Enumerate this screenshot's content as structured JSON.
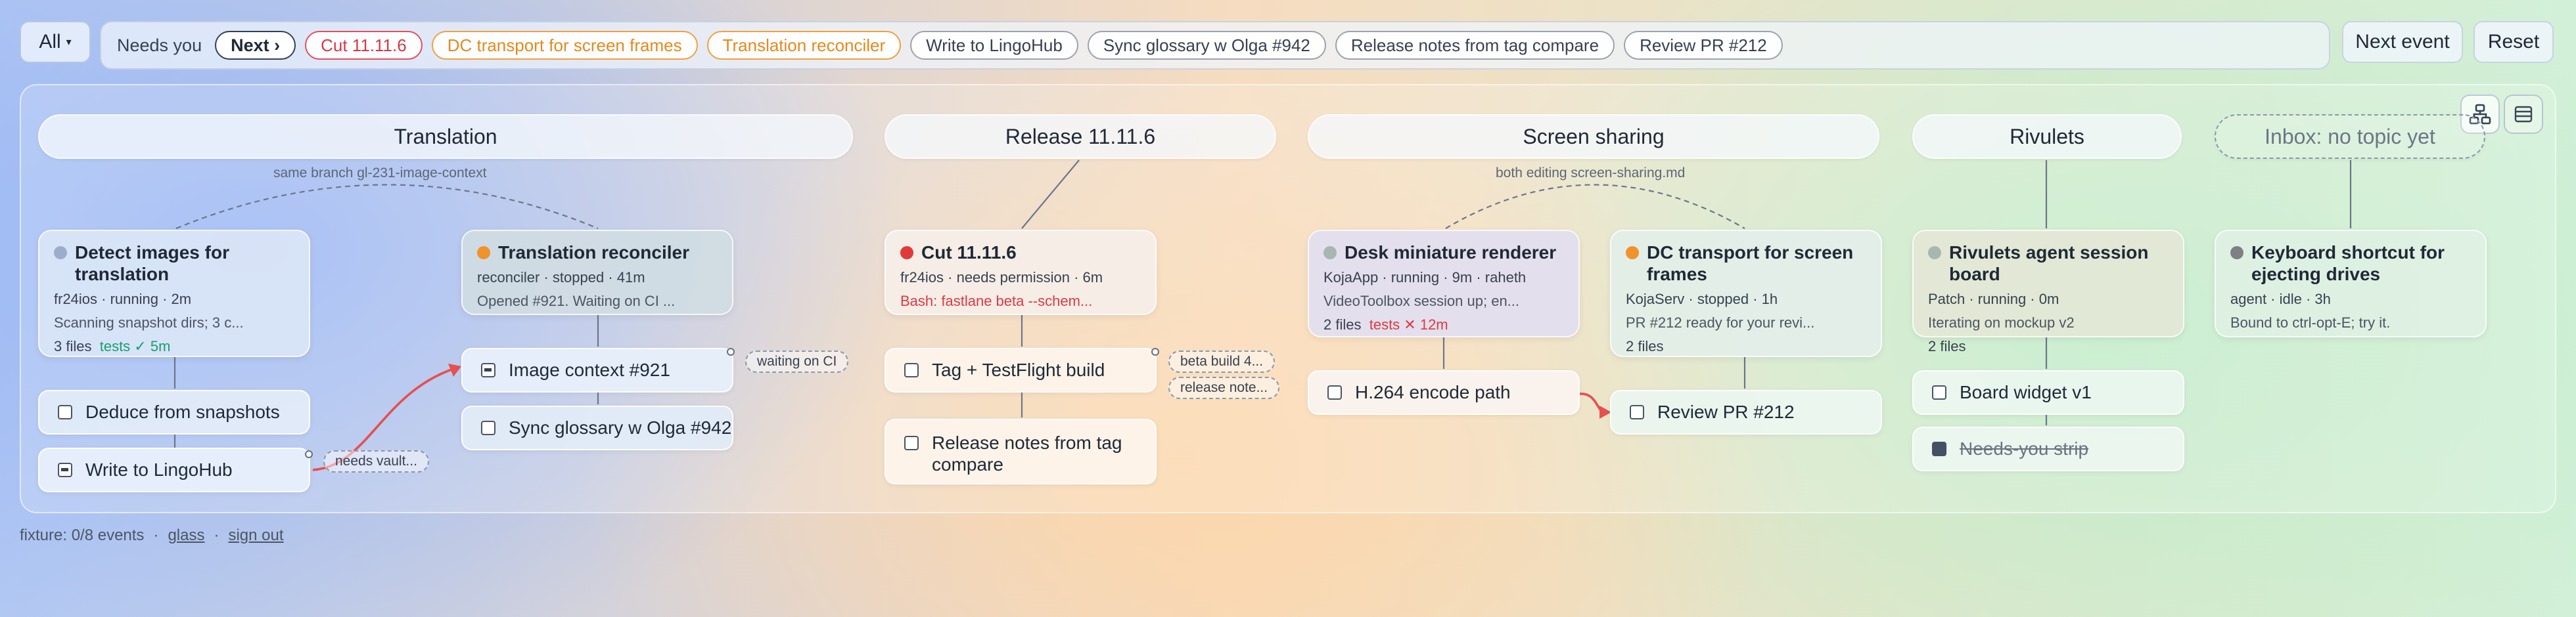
{
  "filter": {
    "label": "All",
    "caret": "▾"
  },
  "needs": {
    "label": "Needs you",
    "next_label": "Next ›",
    "chips": [
      {
        "label": "Cut 11.11.6",
        "tone": "red"
      },
      {
        "label": "DC transport for screen frames",
        "tone": "orange"
      },
      {
        "label": "Translation reconciler",
        "tone": "orange"
      },
      {
        "label": "Write to LingoHub",
        "tone": "neutral"
      },
      {
        "label": "Sync glossary w Olga #942",
        "tone": "neutral"
      },
      {
        "label": "Release notes from tag compare",
        "tone": "neutral"
      },
      {
        "label": "Review PR #212",
        "tone": "neutral"
      }
    ]
  },
  "toolbar": {
    "next_event": "Next event",
    "reset": "Reset"
  },
  "icons": {
    "graph_view": "graph-icon",
    "list_view": "list-icon"
  },
  "topics": {
    "translation": "Translation",
    "release": "Release 11.11.6",
    "screen": "Screen sharing",
    "rivulets": "Rivulets",
    "inbox": "Inbox: no topic yet"
  },
  "links": {
    "translation": "same branch gl-231-image-context",
    "screen": "both editing screen-sharing.md"
  },
  "agents": {
    "detect": {
      "title": "Detect images for translation",
      "status": "fr24ios · running · 2m",
      "message": "Scanning snapshot dirs; 3 c...",
      "files": "3 files",
      "tests": "tests ✓ 5m",
      "dot": "#9aaecb"
    },
    "reconciler": {
      "title": "Translation reconciler",
      "status": "reconciler · stopped · 41m",
      "message": "Opened #921. Waiting on CI ...",
      "dot": "#f0932b"
    },
    "cut": {
      "title": "Cut 11.11.6",
      "status": "fr24ios · needs permission · 6m",
      "message": "Bash: fastlane beta --schem...",
      "dot": "#e03a3a"
    },
    "desk": {
      "title": "Desk miniature renderer",
      "status": "KojaApp · running · 9m · raheth",
      "message": "VideoToolbox session up; en...",
      "files": "2 files",
      "tests": "tests ✕ 12m",
      "dot": "#a8b6b0"
    },
    "dc": {
      "title": "DC transport for screen frames",
      "status": "KojaServ · stopped · 1h",
      "message": "PR #212 ready for your revi...",
      "files": "2 files",
      "dot": "#f0932b"
    },
    "rivulets": {
      "title": "Rivulets agent session board",
      "status": "Patch · running · 0m",
      "message": "Iterating on mockup v2",
      "files": "2 files",
      "dot": "#a8b6b0"
    },
    "keyboard": {
      "title": "Keyboard shortcut for ejecting drives",
      "status": "agent · idle · 3h",
      "message": "Bound to ctrl-opt-E; try it.",
      "dot": "#7e8083"
    }
  },
  "tasks": {
    "deduce": "Deduce from snapshots",
    "lingohub": "Write to LingoHub",
    "image_context": "Image context #921",
    "glossary": "Sync glossary w Olga #942",
    "testflight": "Tag + TestFlight build",
    "release_notes": "Release notes from tag compare",
    "h264": "H.264 encode path",
    "review": "Review PR #212",
    "board_widget": "Board widget v1",
    "strip": "Needs-you strip"
  },
  "pills": {
    "needs_vault": "needs vault...",
    "waiting_ci": "waiting on CI",
    "beta_build": "beta build 4...",
    "release_note": "release note..."
  },
  "footer": {
    "fixture": "fixture: 0/8 events",
    "sep": "·",
    "glass": "glass",
    "signout": "sign out"
  }
}
